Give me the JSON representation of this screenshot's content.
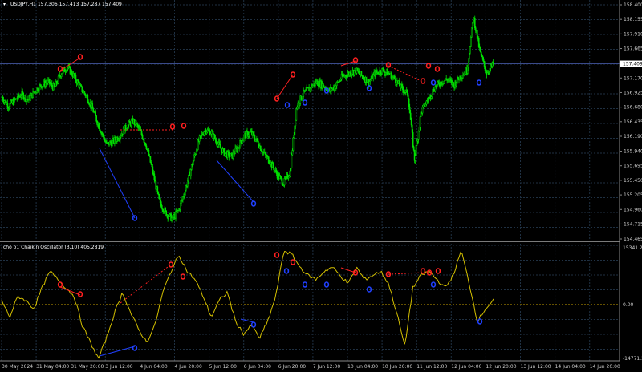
{
  "main_header": {
    "symbol_info": "USDJPY,H1  157.306 157.413 157.287 157.409"
  },
  "indicator_header": {
    "text": "cho o1  Chaikin Oscillator  (3,10) 405.2819"
  },
  "price_axis": {
    "ticks": [
      "158.400",
      "158.155",
      "157.910",
      "157.665",
      "157.170",
      "156.925",
      "156.680",
      "156.435",
      "156.190",
      "155.940",
      "155.695",
      "155.450",
      "155.205",
      "154.960",
      "154.715",
      "154.465"
    ],
    "current_price": "157.409"
  },
  "osc_axis": {
    "top": "15341.238",
    "zero": "0.00",
    "bottom": "-14771.35"
  },
  "time_axis": {
    "labels": [
      "30 May 2024",
      "31 May 04:00",
      "31 May 20:00",
      "3 Jun 12:00",
      "4 Jun 04:00",
      "4 Jun 20:00",
      "5 Jun 12:00",
      "6 Jun 04:00",
      "6 Jun 20:00",
      "7 Jun 12:00",
      "10 Jun 04:00",
      "10 Jun 20:00",
      "11 Jun 12:00",
      "12 Jun 04:00",
      "12 Jun 20:00",
      "13 Jun 12:00",
      "14 Jun 04:00",
      "14 Jun 20:00"
    ]
  },
  "colors": {
    "background": "#000000",
    "bull_candle": "#00ff00",
    "bear_candle": "#00ff00",
    "oscillator": "#d4c000",
    "divergence_bear": "#ff2020",
    "divergence_bull": "#2040ff",
    "grid": "#1a2a3a"
  },
  "chart_data": {
    "type": "candlestick",
    "close_path": [
      156.85,
      156.7,
      156.8,
      156.9,
      156.8,
      156.95,
      157.05,
      157.1,
      157.0,
      157.25,
      157.35,
      157.2,
      157.0,
      156.85,
      156.6,
      156.3,
      156.05,
      156.1,
      156.2,
      156.35,
      156.45,
      156.3,
      156.05,
      155.6,
      155.1,
      154.9,
      154.8,
      154.95,
      155.3,
      155.7,
      156.1,
      156.3,
      156.25,
      156.05,
      155.9,
      155.85,
      156.0,
      156.2,
      156.25,
      156.1,
      155.9,
      155.75,
      155.55,
      155.4,
      155.6,
      156.7,
      156.9,
      157.0,
      157.1,
      157.05,
      156.95,
      157.05,
      157.2,
      157.25,
      157.3,
      157.2,
      157.1,
      157.25,
      157.3,
      157.25,
      157.15,
      157.0,
      156.9,
      155.8,
      156.6,
      156.8,
      157.0,
      157.1,
      157.15,
      157.05,
      157.2,
      157.3,
      158.2,
      157.6,
      157.25,
      157.4
    ],
    "oscillator_path": [
      0.1,
      -0.3,
      0.2,
      0.1,
      -0.1,
      0.4,
      0.8,
      0.6,
      0.4,
      0.2,
      -0.5,
      -0.9,
      -1.3,
      -0.8,
      -0.2,
      0.3,
      -0.2,
      -0.6,
      -0.9,
      -0.5,
      0.3,
      0.8,
      1.2,
      0.8,
      0.6,
      0.2,
      -0.3,
      0.1,
      0.3,
      -0.4,
      -0.7,
      -0.5,
      -0.8,
      -0.4,
      0.2,
      1.3,
      1.2,
      0.9,
      0.7,
      0.6,
      0.8,
      0.9,
      0.7,
      0.5,
      0.9,
      0.6,
      0.7,
      0.8,
      0.5,
      -0.2,
      -1.0,
      0.4,
      0.7,
      0.8,
      0.6,
      0.4,
      0.7,
      1.3,
      0.5,
      -0.4,
      -0.1,
      0.1
    ]
  }
}
